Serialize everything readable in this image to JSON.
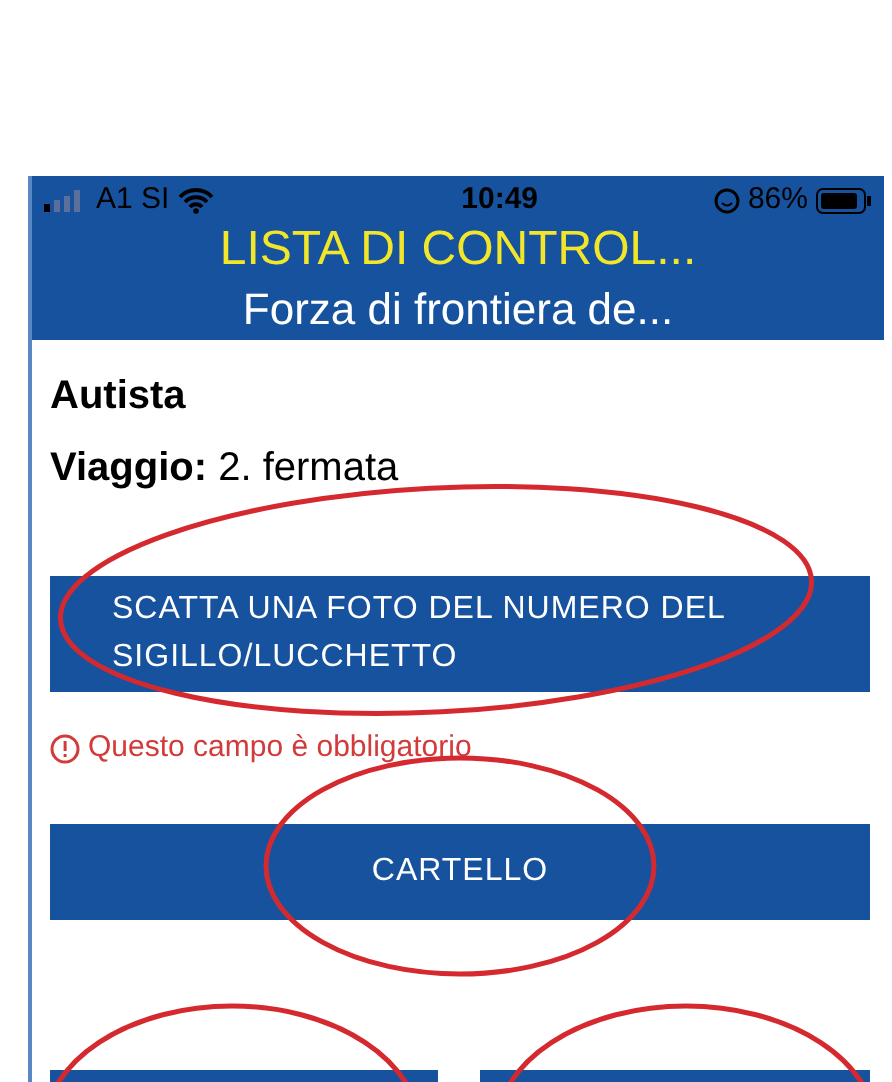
{
  "status_bar": {
    "carrier": "A1 SI",
    "time": "10:49",
    "battery": "86%"
  },
  "header": {
    "title": "LISTA DI CONTROL...",
    "subtitle": "Forza di frontiera de..."
  },
  "driver": {
    "label": "Autista"
  },
  "trip": {
    "label": "Viaggio:",
    "value": "2. fermata"
  },
  "buttons": [
    {
      "label": "SCATTA UNA FOTO DEL NUMERO DEL SIGILLO/LUCCHETTO"
    }
  ],
  "error": {
    "text": "Questo campo è obbligatorio"
  },
  "buttons_2": [
    {
      "label": "CARTELLO"
    }
  ],
  "annotations": [
    {
      "kind": "ellipse",
      "color": "#d42a2f"
    },
    {
      "kind": "ellipse",
      "color": "#d42a2f"
    },
    {
      "kind": "ellipse",
      "color": "#d42a2f"
    },
    {
      "kind": "ellipse",
      "color": "#d42a2f"
    }
  ]
}
